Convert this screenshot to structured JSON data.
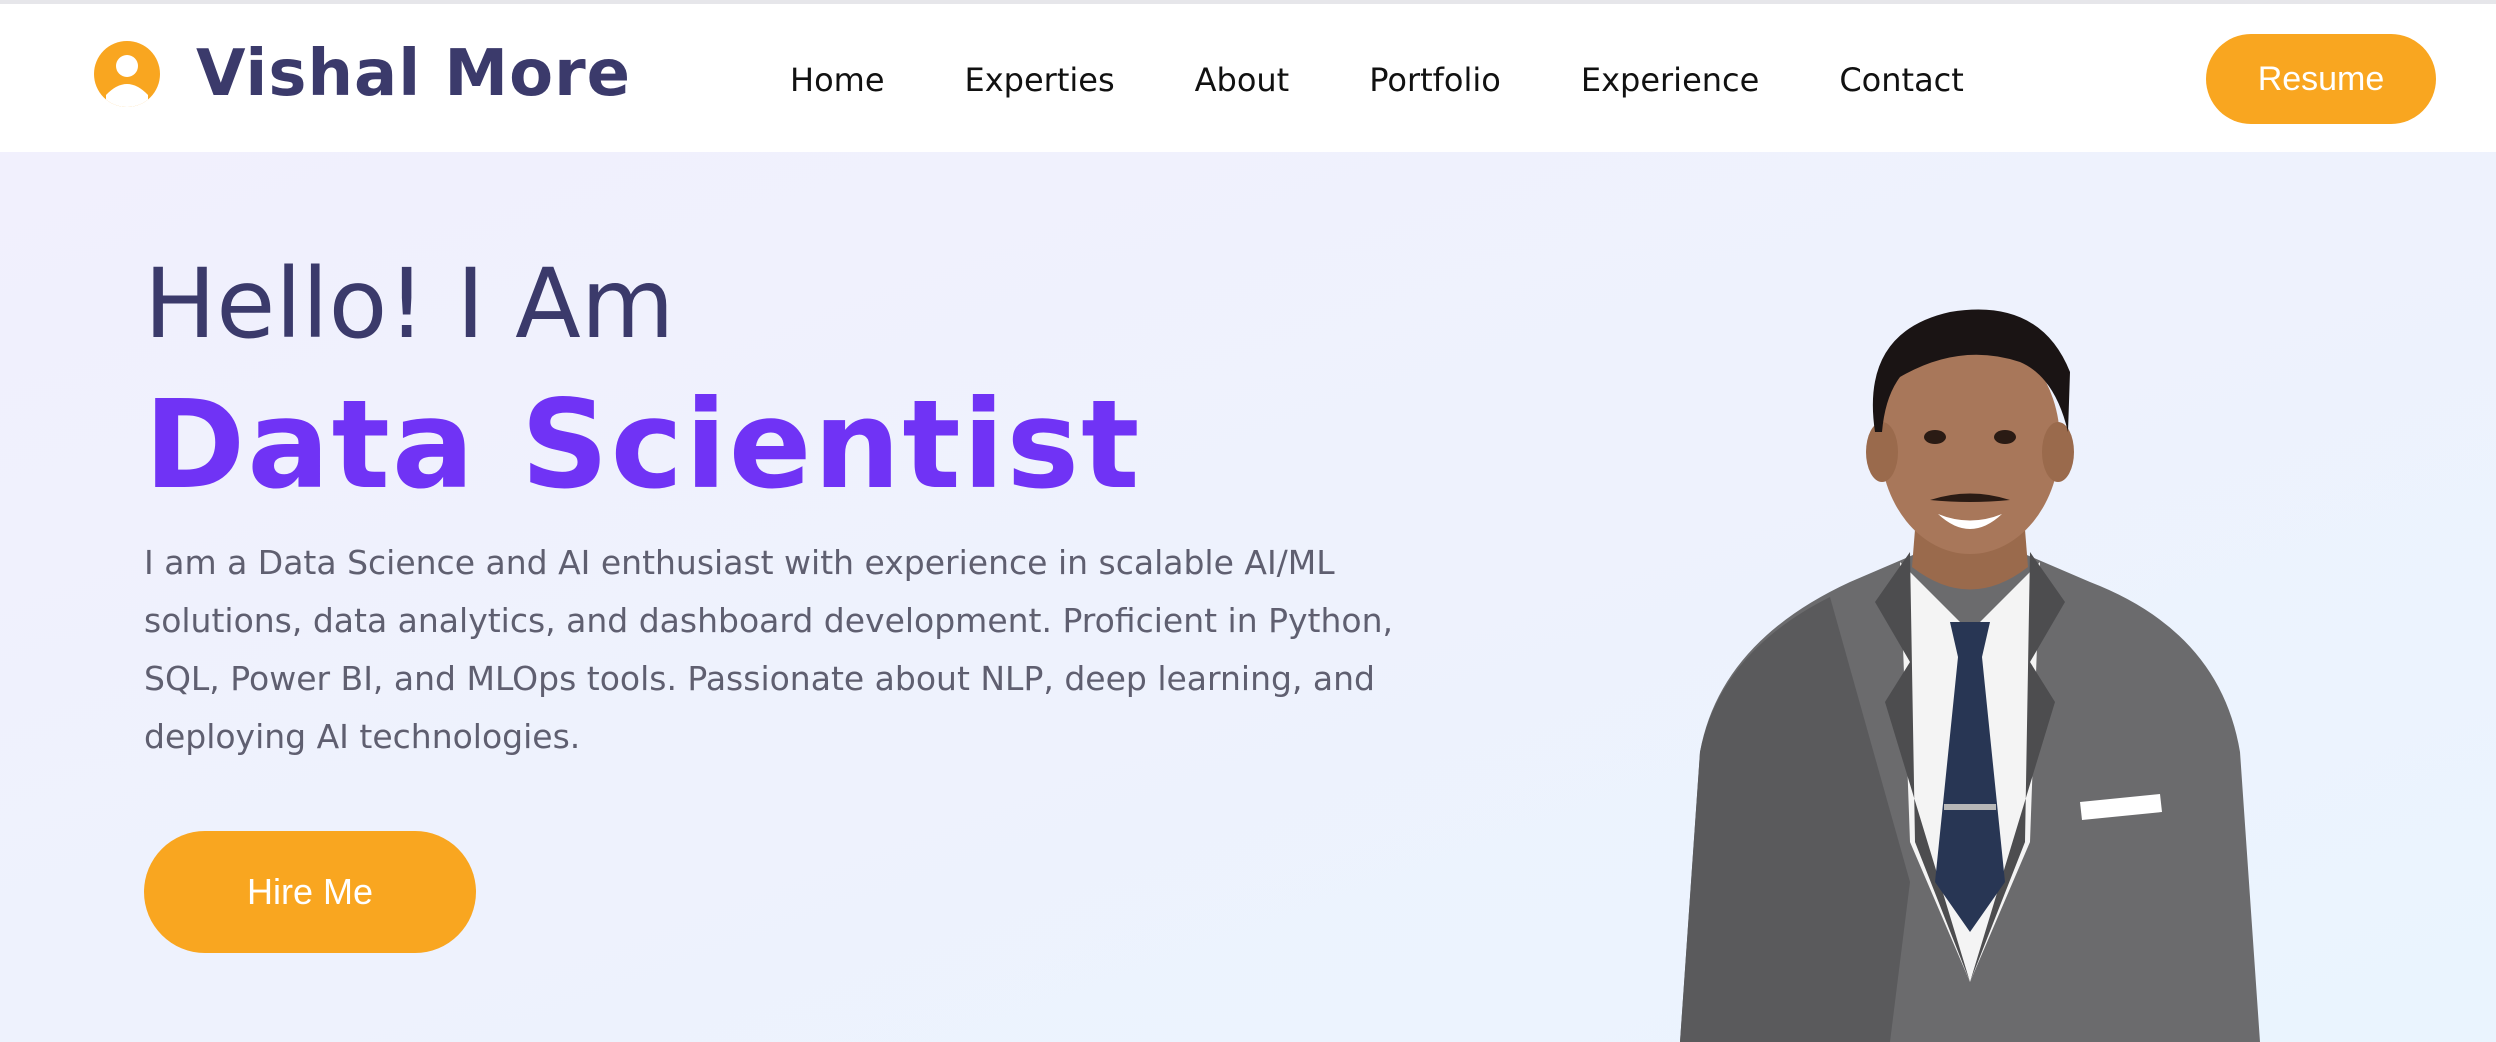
{
  "header": {
    "logo_icon": "user-circle-icon",
    "brand": "Vishal More",
    "nav": [
      "Home",
      "Experties",
      "About",
      "Portfolio",
      "Experience",
      "Contact"
    ],
    "resume_label": "Resume"
  },
  "hero": {
    "greeting": "Hello! I Am",
    "role": "Data Scientist",
    "bio": "I am a Data Science and AI enthusiast with experience in scalable AI/ML solutions, data analytics, and dashboard development. Proficient in Python, SQL, Power BI, and MLOps tools. Passionate about NLP, deep learning, and deploying AI technologies.",
    "hire_label": "Hire Me"
  },
  "colors": {
    "accent": "#f9a620",
    "brand": "#3b3a6b",
    "highlight": "#7033f5"
  }
}
